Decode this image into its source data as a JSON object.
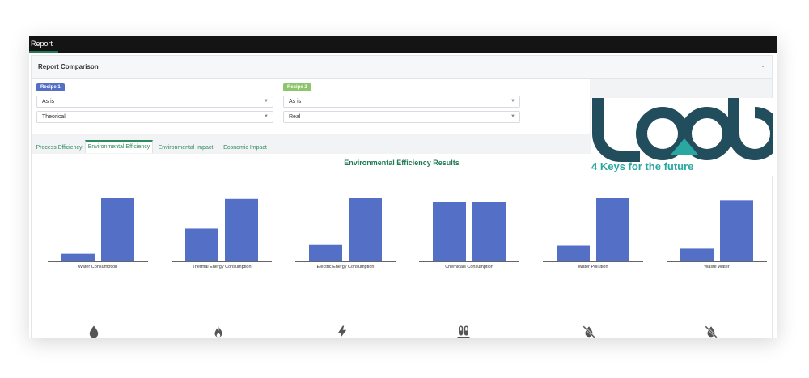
{
  "window": {
    "title": "Report"
  },
  "panel": {
    "title": "Report Comparison"
  },
  "recipe1": {
    "badge": "Recipe 1",
    "select1": "As is",
    "select2": "Theorical"
  },
  "recipe2": {
    "badge": "Recipe 2",
    "select1": "As is",
    "select2": "Real"
  },
  "tabs": [
    {
      "label": "Process Efficiency"
    },
    {
      "label": "Environmental Efficiency"
    },
    {
      "label": "Environmental Impact"
    },
    {
      "label": "Economic Impact"
    }
  ],
  "active_tab": "Environmental Efficiency",
  "logo": {
    "text": "lcab",
    "tagline": "4 Keys for the future"
  },
  "colors": {
    "bar": "#5470c6",
    "accent": "#1f7a54",
    "logo_dark": "#224d5c",
    "logo_teal": "#2aa7a0"
  },
  "chart_data": {
    "type": "bar",
    "title": "Environmental Efficiency Results",
    "categories": [
      "Water Consumption",
      "Thermal Energy Consumption",
      "Electric Energy Consumption",
      "Chemicals Consumption",
      "Water Pollution",
      "Waste Water"
    ],
    "icons": [
      "water-drop-icon",
      "flame-icon",
      "lightning-icon",
      "test-tubes-icon",
      "water-pollution-icon",
      "waste-water-icon"
    ],
    "series": [
      {
        "values": [
          12,
          52,
          26,
          94,
          25,
          20
        ]
      },
      {
        "values": [
          100,
          99,
          100,
          94,
          100,
          97
        ]
      }
    ],
    "ylim": [
      0,
      100
    ],
    "grid": false,
    "legend": "none"
  }
}
